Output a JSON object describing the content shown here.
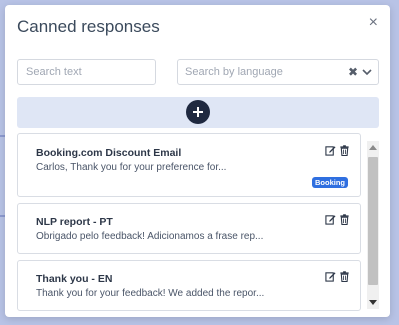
{
  "modal": {
    "title": "Canned responses",
    "close_glyph": "×"
  },
  "filters": {
    "search_placeholder": "Search text",
    "language_placeholder": "Search by language",
    "clear_glyph": "✖"
  },
  "add_button": {
    "icon": "plus-icon"
  },
  "responses": [
    {
      "title": "Booking.com Discount Email",
      "body": "Carlos, Thank you for your preference for...",
      "badge": "Booking"
    },
    {
      "title": "NLP report - PT",
      "body": "Obrigado pelo feedback! Adicionamos a frase rep..."
    },
    {
      "title": "Thank you - EN",
      "body": "Thank you for your feedback! We added the repor..."
    }
  ],
  "colors": {
    "backdrop": "#b8c3e6",
    "add_bar": "#dfe6f5",
    "add_button": "#1f2940",
    "badge": "#2f6fe0"
  }
}
